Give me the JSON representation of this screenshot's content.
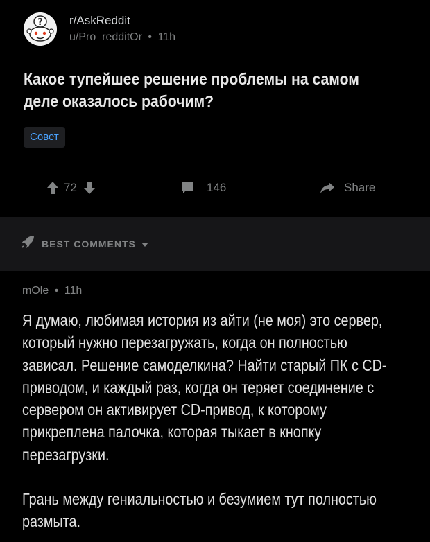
{
  "post": {
    "subreddit": "r/AskReddit",
    "author": "u/Pro_redditOr",
    "separator": "•",
    "age": "11h",
    "title": "Какое тупейшее решение проблемы на самом деле оказалось рабочим?",
    "flair": "Совет",
    "votes": "72",
    "comments": "146",
    "share": "Share"
  },
  "comments_section": {
    "sort_label": "BEST COMMENTS"
  },
  "comment": {
    "author": "mOle",
    "separator": "•",
    "age": "11h",
    "paragraphs": [
      "Я думаю, любимая история из айти (не моя) это сервер, который нужно перезагружать, когда он полностью зависал. Решение самоделкина? Найти старый ПК с CD-приводом, и каждый раз, когда он теряет соединение с сервером он активирует CD-привод, к которому прикреплена палочка, которая тыкает в кнопку перезагрузки.",
      "Грань между гениальностью и безумием тут полностью размыта."
    ]
  },
  "colors": {
    "background": "#000000",
    "separator_band": "#161618",
    "text": "#d7dadc",
    "muted": "#818384",
    "flair_text": "#4aa3ff"
  },
  "icons": [
    "askreddit-avatar-icon",
    "upvote-icon",
    "downvote-icon",
    "comment-icon",
    "share-icon",
    "rocket-icon",
    "chevron-down-icon"
  ]
}
